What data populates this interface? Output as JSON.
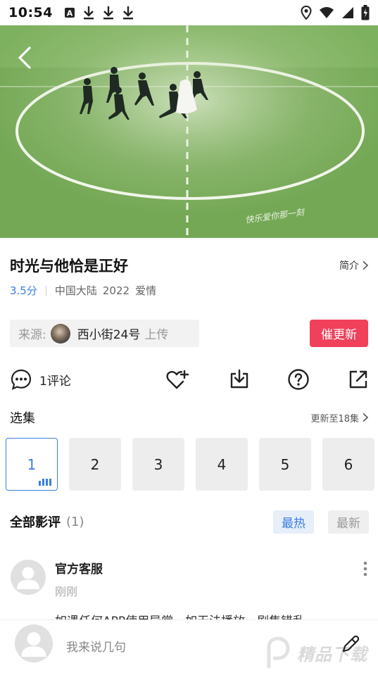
{
  "status_bar": {
    "time": "10:54",
    "left_icons": [
      "a-badge-icon",
      "download-icon",
      "download-icon",
      "download-icon"
    ],
    "right_icons": [
      "location-icon",
      "wifi-icon",
      "signal-icon",
      "battery-icon"
    ]
  },
  "video": {
    "caption": "快乐爱你那一刻"
  },
  "show": {
    "title": "时光与他恰是正好",
    "intro_label": "简介",
    "score": "3.5分",
    "region": "中国大陆",
    "year": "2022",
    "genre": "爱情"
  },
  "source": {
    "label": "来源:",
    "uploader": "西小街24号",
    "suffix": "上传",
    "urge_label": "催更新"
  },
  "actions": {
    "comment_label": "1评论",
    "icons": [
      "heart-plus-icon",
      "download-icon",
      "help-icon",
      "share-icon"
    ]
  },
  "episodes": {
    "title": "选集",
    "update_label": "更新至18集",
    "items": [
      "1",
      "2",
      "3",
      "4",
      "5",
      "6"
    ],
    "active_index": 0
  },
  "reviews": {
    "title": "全部影评",
    "count": "(1)",
    "sort_hot": "最热",
    "sort_new": "最新",
    "items": [
      {
        "name": "官方客服",
        "time": "刚刚",
        "text": "如遇任何APP使用异常，如无法播放，剧集错乱"
      }
    ]
  },
  "bottom_bar": {
    "placeholder": "我来说几句",
    "watermark": "精品下载"
  },
  "colors": {
    "accent_blue": "#3b7de0",
    "urge_red": "#f0405a",
    "field_green": "#7fae5c"
  }
}
